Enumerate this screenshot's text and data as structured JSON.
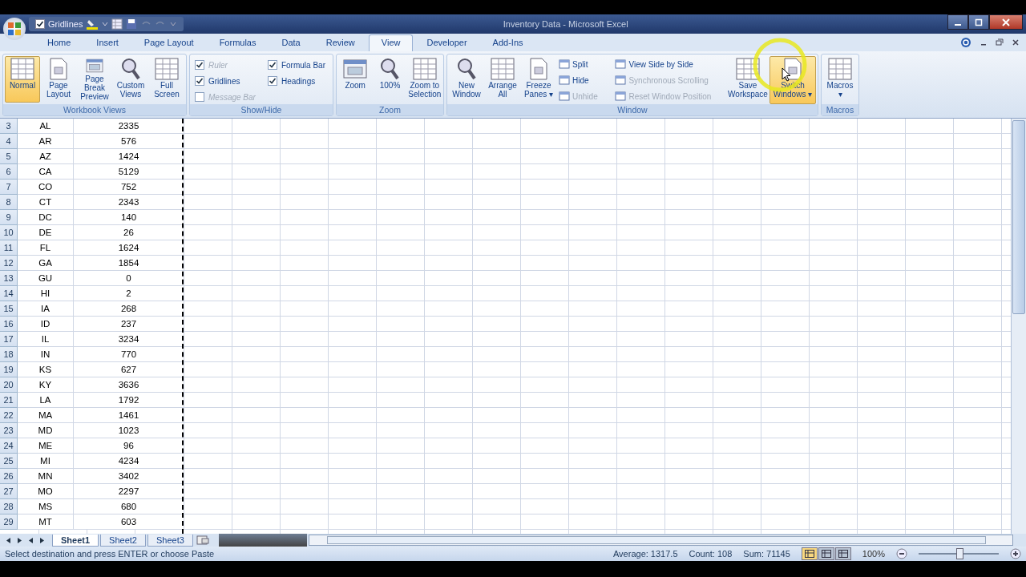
{
  "quick_access": {
    "checkbox": {
      "label": "Gridlines",
      "checked": true
    }
  },
  "window": {
    "title": "Inventory Data - Microsoft Excel"
  },
  "tabs": [
    {
      "label": "Home",
      "selected": false
    },
    {
      "label": "Insert",
      "selected": false
    },
    {
      "label": "Page Layout",
      "selected": false
    },
    {
      "label": "Formulas",
      "selected": false
    },
    {
      "label": "Data",
      "selected": false
    },
    {
      "label": "Review",
      "selected": false
    },
    {
      "label": "View",
      "selected": true
    },
    {
      "label": "Developer",
      "selected": false
    },
    {
      "label": "Add-Ins",
      "selected": false
    }
  ],
  "ribbon": [
    {
      "title": "Workbook Views",
      "items": [
        {
          "kind": "big",
          "label": "Normal",
          "active": true
        },
        {
          "kind": "big",
          "label": "Page Layout",
          "active": false
        },
        {
          "kind": "big",
          "label": "Page Break Preview",
          "active": false
        },
        {
          "kind": "big",
          "label": "Custom Views",
          "active": false
        },
        {
          "kind": "big",
          "label": "Full Screen",
          "active": false
        }
      ]
    },
    {
      "title": "Show/Hide",
      "items": [
        {
          "kind": "check",
          "label": "Ruler",
          "checked": true,
          "disabled": true
        },
        {
          "kind": "check",
          "label": "Gridlines",
          "checked": true,
          "disabled": false
        },
        {
          "kind": "check",
          "label": "Message Bar",
          "checked": false,
          "disabled": true
        },
        {
          "kind": "check",
          "label": "Formula Bar",
          "checked": true,
          "disabled": false
        },
        {
          "kind": "check",
          "label": "Headings",
          "checked": true,
          "disabled": false
        }
      ]
    },
    {
      "title": "Zoom",
      "items": [
        {
          "kind": "big",
          "label": "Zoom",
          "active": false
        },
        {
          "kind": "big",
          "label": "100%",
          "active": false
        },
        {
          "kind": "big",
          "label": "Zoom to Selection",
          "active": false
        }
      ]
    },
    {
      "title": "Window",
      "items": [
        {
          "kind": "big",
          "label": "New Window",
          "active": false
        },
        {
          "kind": "big",
          "label": "Arrange All",
          "active": false
        },
        {
          "kind": "big",
          "label": "Freeze Panes ▾",
          "active": false
        },
        {
          "kind": "small",
          "label": "Split",
          "disabled": false
        },
        {
          "kind": "small",
          "label": "Hide",
          "disabled": false
        },
        {
          "kind": "small",
          "label": "Unhide",
          "disabled": true
        },
        {
          "kind": "small",
          "label": "View Side by Side",
          "disabled": false
        },
        {
          "kind": "small",
          "label": "Synchronous Scrolling",
          "disabled": true
        },
        {
          "kind": "small",
          "label": "Reset Window Position",
          "disabled": true
        },
        {
          "kind": "big",
          "label": "Save Workspace",
          "active": false
        },
        {
          "kind": "big",
          "label": "Switch Windows ▾",
          "active": true
        }
      ]
    },
    {
      "title": "Macros",
      "items": [
        {
          "kind": "big",
          "label": "Macros ▾",
          "active": false
        }
      ]
    }
  ],
  "sheet": {
    "rows": [
      {
        "row": "3",
        "state": "AL",
        "value": "2335"
      },
      {
        "row": "4",
        "state": "AR",
        "value": "576"
      },
      {
        "row": "5",
        "state": "AZ",
        "value": "1424"
      },
      {
        "row": "6",
        "state": "CA",
        "value": "5129"
      },
      {
        "row": "7",
        "state": "CO",
        "value": "752"
      },
      {
        "row": "8",
        "state": "CT",
        "value": "2343"
      },
      {
        "row": "9",
        "state": "DC",
        "value": "140"
      },
      {
        "row": "10",
        "state": "DE",
        "value": "26"
      },
      {
        "row": "11",
        "state": "FL",
        "value": "1624"
      },
      {
        "row": "12",
        "state": "GA",
        "value": "1854"
      },
      {
        "row": "13",
        "state": "GU",
        "value": "0"
      },
      {
        "row": "14",
        "state": "HI",
        "value": "2"
      },
      {
        "row": "15",
        "state": "IA",
        "value": "268"
      },
      {
        "row": "16",
        "state": "ID",
        "value": "237"
      },
      {
        "row": "17",
        "state": "IL",
        "value": "3234"
      },
      {
        "row": "18",
        "state": "IN",
        "value": "770"
      },
      {
        "row": "19",
        "state": "KS",
        "value": "627"
      },
      {
        "row": "20",
        "state": "KY",
        "value": "3636"
      },
      {
        "row": "21",
        "state": "LA",
        "value": "1792"
      },
      {
        "row": "22",
        "state": "MA",
        "value": "1461"
      },
      {
        "row": "23",
        "state": "MD",
        "value": "1023"
      },
      {
        "row": "24",
        "state": "ME",
        "value": "96"
      },
      {
        "row": "25",
        "state": "MI",
        "value": "4234"
      },
      {
        "row": "26",
        "state": "MN",
        "value": "3402"
      },
      {
        "row": "27",
        "state": "MO",
        "value": "2297"
      },
      {
        "row": "28",
        "state": "MS",
        "value": "680"
      },
      {
        "row": "29",
        "state": "MT",
        "value": "603"
      }
    ]
  },
  "sheet_tabs": [
    {
      "label": "Sheet1",
      "selected": true
    },
    {
      "label": "Sheet2",
      "selected": false
    },
    {
      "label": "Sheet3",
      "selected": false
    }
  ],
  "status_bar": {
    "message": "Select destination and press ENTER or choose Paste",
    "stats": [
      "Average: 1317.5",
      "Count: 108",
      "Sum: 71145"
    ],
    "view_buttons": [
      {
        "selected": true
      },
      {
        "selected": false
      },
      {
        "selected": false
      }
    ],
    "zoom": "100%",
    "zoom_slider": {
      "level": 0.5
    }
  }
}
